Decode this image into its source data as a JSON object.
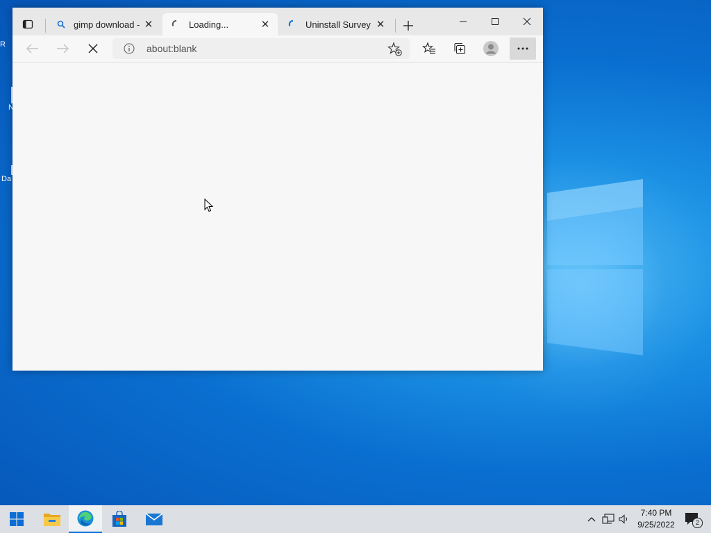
{
  "desktop": {
    "icon_labels": [
      "R",
      "N",
      "Da"
    ]
  },
  "browser": {
    "tabs": [
      {
        "title": "gimp download - S",
        "favicon": "search-icon",
        "active": false
      },
      {
        "title": "Loading...",
        "favicon": "loading-spinner-icon",
        "active": true
      },
      {
        "title": "Uninstall Survey - U",
        "favicon": "loading-spinner-icon",
        "active": false
      }
    ],
    "address_bar": {
      "url": "about:blank"
    },
    "accent": "#0b6ed6"
  },
  "taskbar": {
    "apps": [
      "start-icon",
      "file-explorer-icon",
      "edge-icon",
      "store-icon",
      "mail-icon"
    ],
    "clock": {
      "time": "7:40 PM",
      "date": "9/25/2022"
    },
    "notifications_count": "2"
  }
}
